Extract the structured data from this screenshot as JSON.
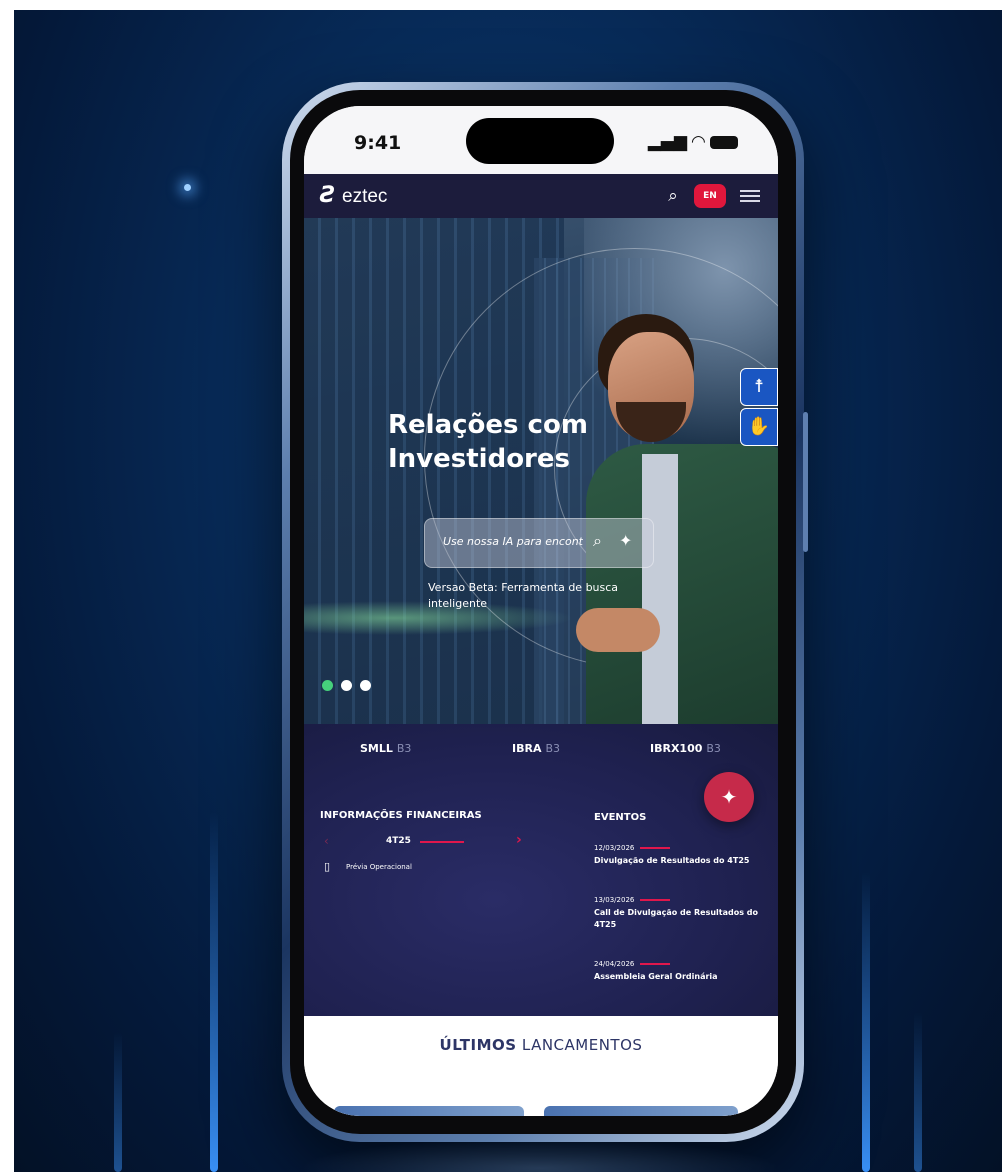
{
  "status_bar": {
    "time": "9:41"
  },
  "brand": {
    "logo_mark": "Ƨ",
    "name": "eztec"
  },
  "nav": {
    "lang_button": "EN"
  },
  "hero": {
    "title_line1": "Relações com",
    "title_line2": "Investidores",
    "search_placeholder": "Use nossa IA para encontrar",
    "beta_note": "Versao Beta: Ferramenta de busca inteligente",
    "slides": 3,
    "active_slide": 1
  },
  "indices": [
    {
      "name": "SMLL",
      "exchange": "B3"
    },
    {
      "name": "IBRA",
      "exchange": "B3"
    },
    {
      "name": "IBRX100",
      "exchange": "B3"
    }
  ],
  "financial_info": {
    "title": "INFORMAÇÕES FINANCEIRAS",
    "period": "4T25",
    "document": "Prévia Operacional"
  },
  "events": {
    "title": "EVENTOS",
    "items": [
      {
        "date": "12/03/2026",
        "text": "Divulgação de Resultados do 4T25"
      },
      {
        "date": "13/03/2026",
        "text": "Call de Divulgação de Resultados do 4T25"
      },
      {
        "date": "24/04/2026",
        "text": "Assembleia Geral Ordinária"
      }
    ]
  },
  "launches": {
    "title_bold": "ÚLTIMOS",
    "title_rest": " LANCAMENTOS"
  },
  "colors": {
    "navbar": "#1c1c3c",
    "accent_red": "#e0173c",
    "active_dot": "#46d07c",
    "dark_section": "#1f2150",
    "a11y_blue": "#1a56c2"
  }
}
